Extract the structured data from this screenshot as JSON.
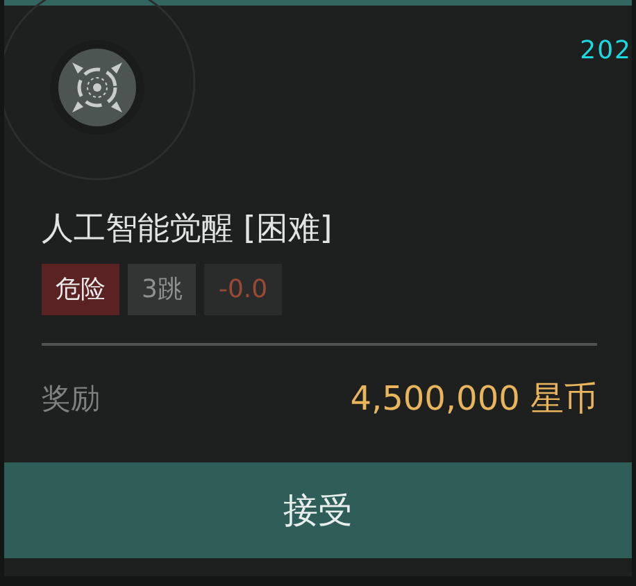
{
  "corner_text": "202",
  "mission": {
    "title": "人工智能觉醒 [困难]",
    "tags": [
      {
        "kind": "danger",
        "text": "危险"
      },
      {
        "kind": "jumps",
        "text": "3跳"
      },
      {
        "kind": "security",
        "text": "-0.0"
      }
    ],
    "reward_label": "奖励",
    "reward_value": "4,500,000 星币"
  },
  "buttons": [
    {
      "label": "接受"
    }
  ]
}
